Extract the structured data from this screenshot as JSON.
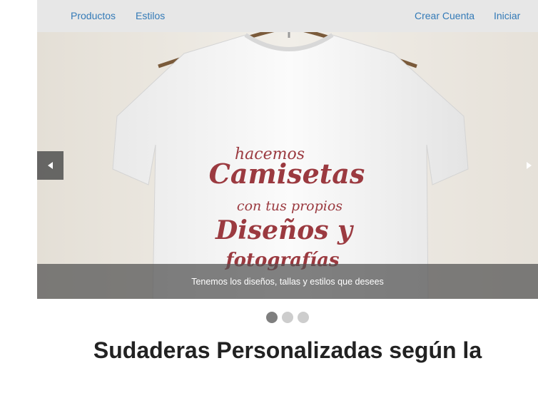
{
  "nav": {
    "left_items": [
      "Productos",
      "Estilos"
    ],
    "right_items": [
      "Crear Cuenta",
      "Iniciar"
    ]
  },
  "carousel": {
    "caption": "Tenemos los diseños, tallas y estilos que desees",
    "shirt_print_lines": [
      "hacemos",
      "Camisetas",
      "con tus propios",
      "Diseños y",
      "fotografías"
    ],
    "slide_count": 3,
    "active_slide": 1
  },
  "main": {
    "heading": "Sudaderas Personalizadas según la"
  },
  "colors": {
    "nav_bg": "#e7e7e7",
    "link": "#337ab7",
    "print": "#9b3a40",
    "dot_active": "#7f7f7f",
    "dot_inactive": "#cdcdcd"
  }
}
